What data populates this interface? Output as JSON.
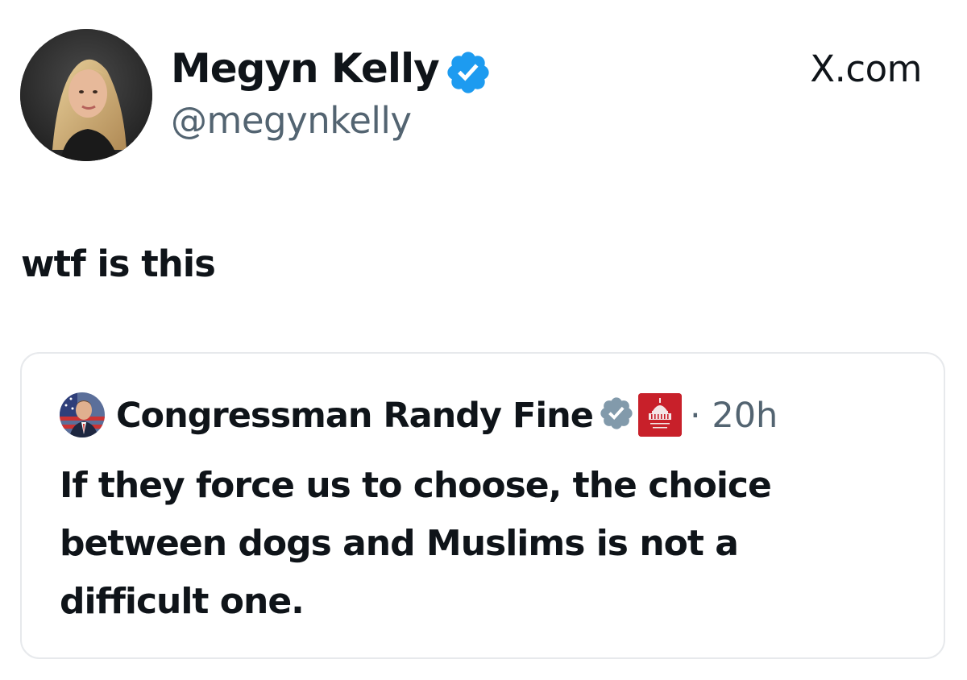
{
  "post": {
    "author": {
      "display_name": "Megyn Kelly",
      "handle": "@megynkelly",
      "verified": true,
      "verified_color": "#1d9bf0",
      "avatar_icon": "profile-photo"
    },
    "source_label": "X.com",
    "text": "wtf is this"
  },
  "quoted_post": {
    "author": {
      "display_name": "Congressman Randy Fine",
      "verified": true,
      "verified_color": "#829aab",
      "affiliate_badge_icon": "house-gop-capitol-badge",
      "affiliate_badge_color": "#c8202a",
      "avatar_icon": "profile-photo-with-flag"
    },
    "timestamp": "· 20h",
    "text_lines": [
      "If they force us to choose, the choice",
      "between dogs and Muslims is not a",
      "difficult one."
    ]
  }
}
